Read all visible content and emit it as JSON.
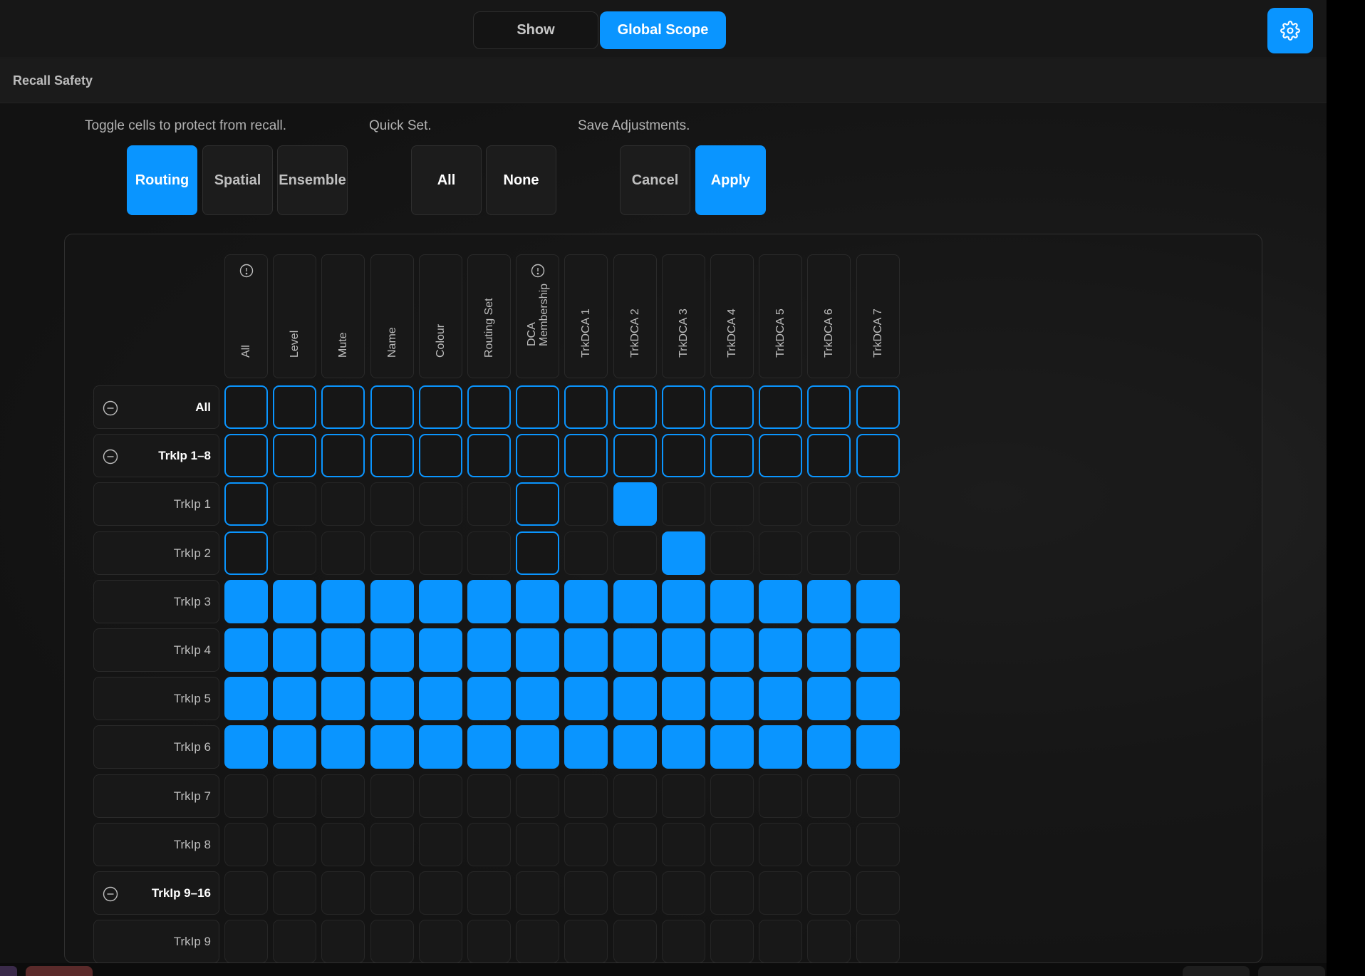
{
  "header": {
    "tabs": [
      {
        "label": "Show",
        "active": false
      },
      {
        "label": "Global Scope",
        "active": true
      }
    ],
    "settings_icon": "gear-icon"
  },
  "subheader": {
    "title": "Recall Safety"
  },
  "instructions": {
    "toggle": "Toggle cells to protect from recall.",
    "quick_set": "Quick Set.",
    "save": "Save Adjustments."
  },
  "modes": [
    {
      "label": "Routing",
      "active": true
    },
    {
      "label": "Spatial",
      "active": false
    },
    {
      "label": "Ensemble",
      "active": false
    }
  ],
  "quick_set": {
    "all_label": "All",
    "none_label": "None"
  },
  "save": {
    "cancel_label": "Cancel",
    "apply_label": "Apply"
  },
  "columns": [
    {
      "label": "All",
      "info": true
    },
    {
      "label": "Level",
      "info": false
    },
    {
      "label": "Mute",
      "info": false
    },
    {
      "label": "Name",
      "info": false
    },
    {
      "label": "Colour",
      "info": false
    },
    {
      "label": "Routing Set",
      "info": false
    },
    {
      "label": "DCA Membership",
      "info": true
    },
    {
      "label": "TrkDCA 1",
      "info": false
    },
    {
      "label": "TrkDCA 2",
      "info": false
    },
    {
      "label": "TrkDCA 3",
      "info": false
    },
    {
      "label": "TrkDCA 4",
      "info": false
    },
    {
      "label": "TrkDCA 5",
      "info": false
    },
    {
      "label": "TrkDCA 6",
      "info": false
    },
    {
      "label": "TrkDCA 7",
      "info": false
    }
  ],
  "rows": [
    {
      "label": "All",
      "group": true,
      "cells": [
        "o",
        "o",
        "o",
        "o",
        "o",
        "o",
        "o",
        "o",
        "o",
        "o",
        "o",
        "o",
        "o",
        "o"
      ]
    },
    {
      "label": "TrkIp 1–8",
      "group": true,
      "cells": [
        "o",
        "o",
        "o",
        "o",
        "o",
        "o",
        "o",
        "o",
        "o",
        "o",
        "o",
        "o",
        "o",
        "o"
      ]
    },
    {
      "label": "TrkIp 1",
      "group": false,
      "cells": [
        "o",
        "e",
        "e",
        "e",
        "e",
        "e",
        "o",
        "e",
        "f",
        "e",
        "e",
        "e",
        "e",
        "e"
      ]
    },
    {
      "label": "TrkIp 2",
      "group": false,
      "cells": [
        "o",
        "e",
        "e",
        "e",
        "e",
        "e",
        "o",
        "e",
        "e",
        "f",
        "e",
        "e",
        "e",
        "e"
      ]
    },
    {
      "label": "TrkIp 3",
      "group": false,
      "cells": [
        "f",
        "f",
        "f",
        "f",
        "f",
        "f",
        "f",
        "f",
        "f",
        "f",
        "f",
        "f",
        "f",
        "f"
      ]
    },
    {
      "label": "TrkIp 4",
      "group": false,
      "cells": [
        "f",
        "f",
        "f",
        "f",
        "f",
        "f",
        "f",
        "f",
        "f",
        "f",
        "f",
        "f",
        "f",
        "f"
      ]
    },
    {
      "label": "TrkIp 5",
      "group": false,
      "cells": [
        "f",
        "f",
        "f",
        "f",
        "f",
        "f",
        "f",
        "f",
        "f",
        "f",
        "f",
        "f",
        "f",
        "f"
      ]
    },
    {
      "label": "TrkIp 6",
      "group": false,
      "cells": [
        "f",
        "f",
        "f",
        "f",
        "f",
        "f",
        "f",
        "f",
        "f",
        "f",
        "f",
        "f",
        "f",
        "f"
      ]
    },
    {
      "label": "TrkIp 7",
      "group": false,
      "cells": [
        "e",
        "e",
        "e",
        "e",
        "e",
        "e",
        "e",
        "e",
        "e",
        "e",
        "e",
        "e",
        "e",
        "e"
      ]
    },
    {
      "label": "TrkIp 8",
      "group": false,
      "cells": [
        "e",
        "e",
        "e",
        "e",
        "e",
        "e",
        "e",
        "e",
        "e",
        "e",
        "e",
        "e",
        "e",
        "e"
      ]
    },
    {
      "label": "TrkIp 9–16",
      "group": true,
      "cells": [
        "e",
        "e",
        "e",
        "e",
        "e",
        "e",
        "e",
        "e",
        "e",
        "e",
        "e",
        "e",
        "e",
        "e"
      ]
    },
    {
      "label": "TrkIp 9",
      "group": false,
      "cells": [
        "e",
        "e",
        "e",
        "e",
        "e",
        "e",
        "e",
        "e",
        "e",
        "e",
        "e",
        "e",
        "e",
        "e"
      ]
    }
  ],
  "colors": {
    "accent": "#0a95ff",
    "cell_empty": "#181818",
    "background": "#121212"
  }
}
